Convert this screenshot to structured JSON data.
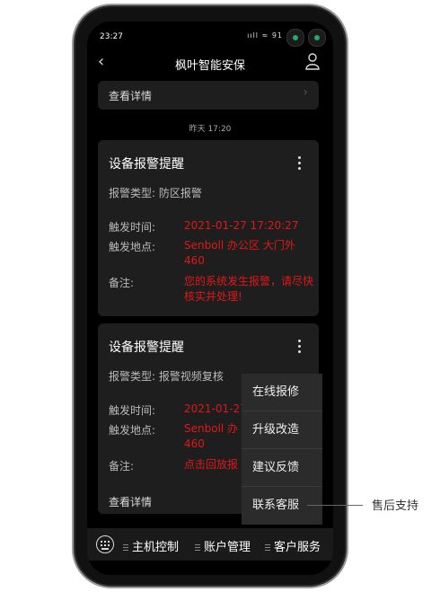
{
  "status": {
    "time": "23:27",
    "indicators": "ııll ≈ 91"
  },
  "header": {
    "title": "枫叶智能安保"
  },
  "top_card": {
    "label": "查看详情"
  },
  "timestamp": "昨天 17:20",
  "alarms": [
    {
      "title": "设备报警提醒",
      "type_label": "报警类型:",
      "type_value": "防区报警",
      "time_label": "触发时间:",
      "time_value": "2021-01-27 17:20:27",
      "location_label": "触发地点:",
      "location_value": "Senboll 办公区 大门外 460",
      "note_label": "备注:",
      "note_value": "您的系统发生报警，请尽快核实并处理!"
    },
    {
      "title": "设备报警提醒",
      "type_label": "报警类型:",
      "type_value": "报警视频复核",
      "time_label": "触发时间:",
      "time_value": "2021-01-27",
      "location_label": "触发地点:",
      "location_value": "Senboll 办 460",
      "note_label": "备注:",
      "note_value": "点击回放报",
      "link": "查看详情"
    }
  ],
  "menu": {
    "items": [
      "在线报修",
      "升级改造",
      "建议反馈",
      "联系客服"
    ]
  },
  "tabbar": {
    "tabs": [
      "主机控制",
      "账户管理",
      "客户服务"
    ]
  },
  "callout": "售后支持"
}
